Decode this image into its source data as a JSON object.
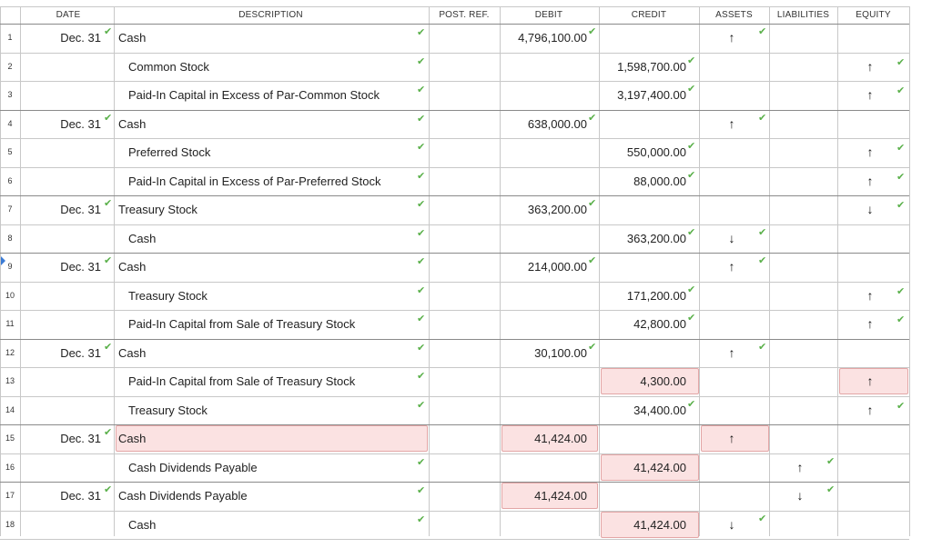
{
  "headers": {
    "date": "DATE",
    "description": "DESCRIPTION",
    "post_ref": "POST. REF.",
    "debit": "DEBIT",
    "credit": "CREDIT",
    "assets": "ASSETS",
    "liabilities": "LIABILITIES",
    "equity": "EQUITY"
  },
  "highlight_color": "#fbe2e2",
  "check_color": "#5ab04a",
  "rows": [
    {
      "num": "1",
      "date": "Dec. 31",
      "desc": "Cash",
      "indent": false,
      "debit": "4,796,100.00",
      "credit": "",
      "assets": "↑",
      "liab": "",
      "equity": "",
      "dark_top": true
    },
    {
      "num": "2",
      "date": "",
      "desc": "Common Stock",
      "indent": true,
      "debit": "",
      "credit": "1,598,700.00",
      "assets": "",
      "liab": "",
      "equity": "↑"
    },
    {
      "num": "3",
      "date": "",
      "desc": "Paid-In Capital in Excess of Par-Common Stock",
      "indent": true,
      "debit": "",
      "credit": "3,197,400.00",
      "assets": "",
      "liab": "",
      "equity": "↑"
    },
    {
      "num": "4",
      "date": "Dec. 31",
      "desc": "Cash",
      "indent": false,
      "debit": "638,000.00",
      "credit": "",
      "assets": "↑",
      "liab": "",
      "equity": "",
      "dark_top": true
    },
    {
      "num": "5",
      "date": "",
      "desc": "Preferred Stock",
      "indent": true,
      "debit": "",
      "credit": "550,000.00",
      "assets": "",
      "liab": "",
      "equity": "↑"
    },
    {
      "num": "6",
      "date": "",
      "desc": "Paid-In Capital in Excess of Par-Preferred Stock",
      "indent": true,
      "debit": "",
      "credit": "88,000.00",
      "assets": "",
      "liab": "",
      "equity": "↑"
    },
    {
      "num": "7",
      "date": "Dec. 31",
      "desc": "Treasury Stock",
      "indent": false,
      "debit": "363,200.00",
      "credit": "",
      "assets": "",
      "liab": "",
      "equity": "↓",
      "dark_top": true
    },
    {
      "num": "8",
      "date": "",
      "desc": "Cash",
      "indent": true,
      "debit": "",
      "credit": "363,200.00",
      "assets": "↓",
      "liab": "",
      "equity": ""
    },
    {
      "num": "9",
      "date": "Dec. 31",
      "desc": "Cash",
      "indent": false,
      "debit": "214,000.00",
      "credit": "",
      "assets": "↑",
      "liab": "",
      "equity": "",
      "dark_top": true
    },
    {
      "num": "10",
      "date": "",
      "desc": "Treasury Stock",
      "indent": true,
      "debit": "",
      "credit": "171,200.00",
      "assets": "",
      "liab": "",
      "equity": "↑"
    },
    {
      "num": "11",
      "date": "",
      "desc": "Paid-In Capital from Sale of Treasury Stock",
      "indent": true,
      "debit": "",
      "credit": "42,800.00",
      "assets": "",
      "liab": "",
      "equity": "↑"
    },
    {
      "num": "12",
      "date": "Dec. 31",
      "desc": "Cash",
      "indent": false,
      "debit": "30,100.00",
      "credit": "",
      "assets": "↑",
      "liab": "",
      "equity": "",
      "dark_top": true
    },
    {
      "num": "13",
      "date": "",
      "desc": "Paid-In Capital from Sale of Treasury Stock",
      "indent": true,
      "debit": "",
      "credit": "4,300.00",
      "assets": "",
      "liab": "",
      "equity": "↑",
      "credit_pink": true,
      "equity_pink": true,
      "no_credit_check": true,
      "no_equity_check": true
    },
    {
      "num": "14",
      "date": "",
      "desc": "Treasury Stock",
      "indent": true,
      "debit": "",
      "credit": "34,400.00",
      "assets": "",
      "liab": "",
      "equity": "↑"
    },
    {
      "num": "15",
      "date": "Dec. 31",
      "desc": "Cash",
      "indent": false,
      "debit": "41,424.00",
      "credit": "",
      "assets": "↑",
      "liab": "",
      "equity": "",
      "dark_top": true,
      "desc_pink": true,
      "debit_pink": true,
      "assets_pink": true,
      "no_desc_check": true,
      "no_debit_check": true,
      "no_assets_check": true
    },
    {
      "num": "16",
      "date": "",
      "desc": "Cash Dividends Payable",
      "indent": true,
      "debit": "",
      "credit": "41,424.00",
      "assets": "",
      "liab": "↑",
      "equity": "",
      "credit_pink": true,
      "no_credit_check": true
    },
    {
      "num": "17",
      "date": "Dec. 31",
      "desc": "Cash Dividends Payable",
      "indent": false,
      "debit": "41,424.00",
      "credit": "",
      "assets": "",
      "liab": "↓",
      "equity": "",
      "dark_top": true,
      "debit_pink": true,
      "no_debit_check": true
    },
    {
      "num": "18",
      "date": "",
      "desc": "Cash",
      "indent": true,
      "debit": "",
      "credit": "41,424.00",
      "assets": "↓",
      "liab": "",
      "equity": "",
      "credit_pink": true,
      "no_credit_check": true
    }
  ]
}
